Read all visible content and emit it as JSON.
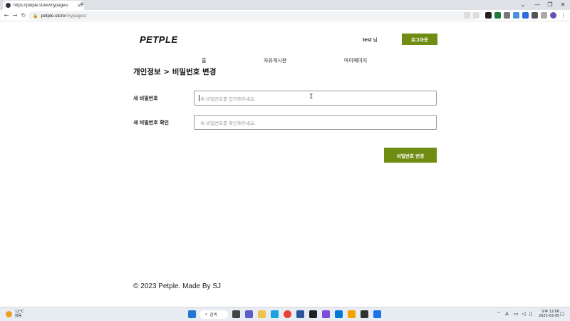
{
  "browser": {
    "tab_title": "https://petple.store/mypages/",
    "tab_close": "×",
    "new_tab": "+",
    "url_host": "petple.store",
    "url_path": "/mypages/",
    "minimize": "—",
    "maximize": "❐",
    "close": "✕",
    "collapse": "⌄"
  },
  "header": {
    "logo": "PETPLE",
    "user": "test",
    "user_suffix": " 님",
    "logout_label": "로그아웃"
  },
  "nav": {
    "home": "홈",
    "board": "자유게시판",
    "mypage": "마이페이지"
  },
  "main": {
    "title": "개인정보 > 비밀번호 변경",
    "new_password_label": "새 비밀번호",
    "new_password_placeholder": "새 비밀번호를 입력해주세요.",
    "confirm_password_label": "새 비밀번호 확인",
    "confirm_password_placeholder": "새 비밀번호를 확인해주세요.",
    "submit_label": "비밀번호 변경"
  },
  "footer": {
    "text": "© 2023 Petple. Made By SJ"
  },
  "taskbar": {
    "temp": "12°C",
    "weather": "맑음",
    "search": "검색",
    "time": "오후 12:06",
    "date": "2023-03-05"
  },
  "colors": {
    "accent": "#6f8c13"
  }
}
